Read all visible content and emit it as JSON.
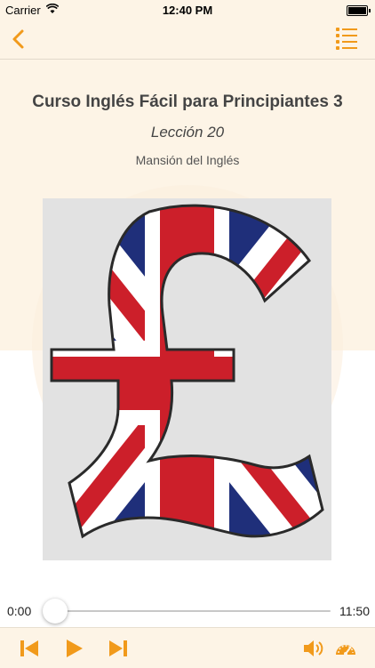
{
  "status_bar": {
    "carrier": "Carrier",
    "time": "12:40 PM"
  },
  "nav": {
    "back_icon": "chevron-left-icon",
    "list_icon": "list-icon"
  },
  "episode": {
    "title": "Curso Inglés Fácil para Principiantes 3",
    "subtitle": "Lección 20",
    "author": "Mansión del Inglés"
  },
  "artwork": {
    "description_icon": "union-jack-pound-sign-artwork"
  },
  "player": {
    "elapsed": "0:00",
    "duration": "11:50",
    "progress_fraction": 0.0
  },
  "toolbar": {
    "icons": [
      "skip-back-icon",
      "play-icon",
      "skip-forward-icon",
      "volume-icon",
      "speed-gauge-icon"
    ]
  },
  "colors": {
    "accent": "#f19a1b",
    "background": "#fdf4e6"
  }
}
